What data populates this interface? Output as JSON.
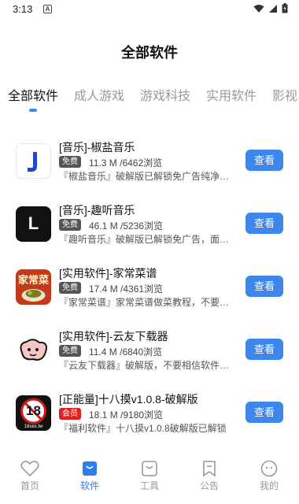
{
  "status": {
    "time": "3:13",
    "notif_letter": "A"
  },
  "header": {
    "title": "全部软件"
  },
  "tabs": [
    "全部软件",
    "成人游戏",
    "游戏科技",
    "实用软件",
    "影视"
  ],
  "apps": [
    {
      "name": "[音乐]-椒盐音乐",
      "badge": "免费",
      "meta": "11.3 M /6462浏览",
      "desc": "『椒盐音乐』破解版已解锁免广告纯净版，",
      "button": "查看"
    },
    {
      "name": "[音乐]-趣听音乐",
      "badge": "免费",
      "meta": "46.1 M /5236浏览",
      "desc": "『趣听音乐』破解版已解锁免广告，面会员",
      "button": "查看"
    },
    {
      "name": "[实用软件]-家常菜谱",
      "badge": "免费",
      "meta": "17.4 M /4361浏览",
      "desc": "『家常菜谱』家常菜谱做菜教程，不要相信",
      "button": "查看"
    },
    {
      "name": "[实用软件]-云友下载器",
      "badge": "免费",
      "meta": "11.4 M /6840浏览",
      "desc": "『云友下载器』破解版，不要相信软件内的",
      "button": "查看"
    },
    {
      "name": "[正能量]十八摸v1.0.8-破解版",
      "badge": "会员",
      "meta": "18.1 M /9180浏览",
      "desc": "『福利软件』十八摸v1.0.8破解版已解锁",
      "button": "查看"
    }
  ],
  "app_icons": {
    "app2_letter": "L",
    "app3_text": "家常菜",
    "app5_number": "18",
    "app5_caption": "18sex.tw"
  },
  "nav": [
    {
      "label": "首页",
      "icon": "heart-icon"
    },
    {
      "label": "软件",
      "icon": "shopping-bag-icon"
    },
    {
      "label": "工具",
      "icon": "bag-icon"
    },
    {
      "label": "公告",
      "icon": "bookmark-icon"
    },
    {
      "label": "我的",
      "icon": "face-icon"
    }
  ],
  "colors": {
    "accent": "#3f86ec",
    "nav_active": "#2e7ef2",
    "vip_badge": "#e02020",
    "free_badge": "#555555"
  }
}
